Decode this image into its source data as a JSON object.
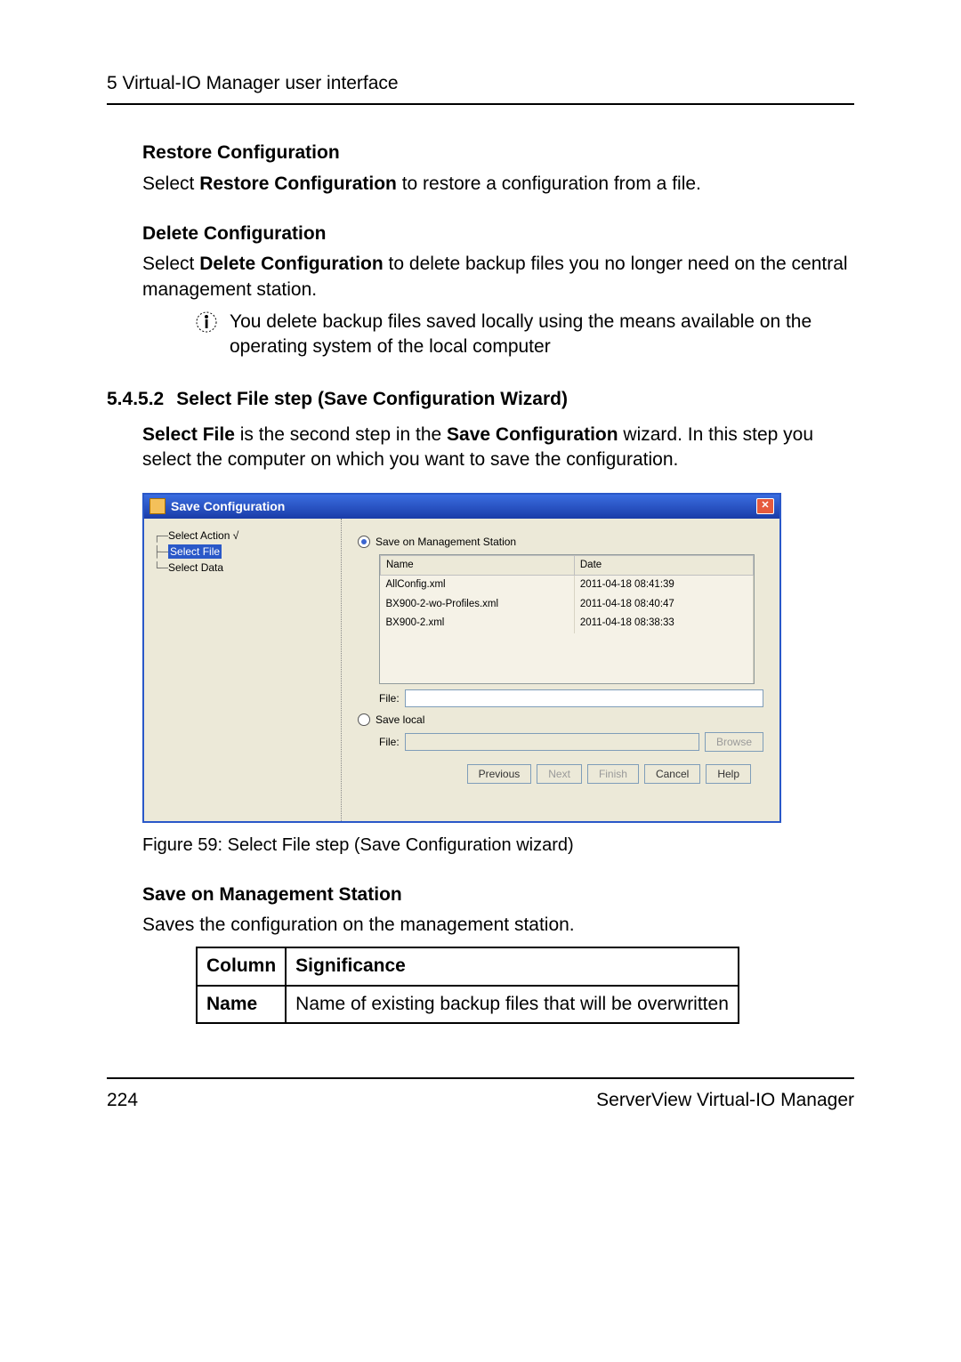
{
  "header": {
    "running": "5 Virtual-IO Manager user interface"
  },
  "restore": {
    "title": "Restore Configuration",
    "text_pre": "Select ",
    "text_bold": "Restore Configuration",
    "text_post": " to restore a configuration from a file."
  },
  "delete": {
    "title": "Delete Configuration",
    "text_pre": "Select ",
    "text_bold": "Delete Configuration",
    "text_post": " to delete backup files you no longer need on the central management station.",
    "note": "You delete backup files saved locally using the means available on the operating system of the local computer"
  },
  "section": {
    "num": "5.4.5.2",
    "title": "Select File step (Save Configuration Wizard)",
    "para_bold1": "Select File",
    "para_mid": " is the second step in the ",
    "para_bold2": "Save Configuration",
    "para_end": " wizard. In this step you select the computer on which you want to save the configuration."
  },
  "wizard": {
    "title": "Save Configuration",
    "tree": {
      "item0": "Select Action √",
      "item1": "Select File",
      "item2": "Select Data"
    },
    "radio_mgmt": "Save on Management Station",
    "radio_local": "Save local",
    "col_name": "Name",
    "col_date": "Date",
    "rows": [
      {
        "name": "AllConfig.xml",
        "date": "2011-04-18 08:41:39"
      },
      {
        "name": "BX900-2-wo-Profiles.xml",
        "date": "2011-04-18 08:40:47"
      },
      {
        "name": "BX900-2.xml",
        "date": "2011-04-18 08:38:33"
      }
    ],
    "file_label": "File:",
    "browse": "Browse",
    "buttons": {
      "prev": "Previous",
      "next": "Next",
      "finish": "Finish",
      "cancel": "Cancel",
      "help": "Help"
    }
  },
  "caption": "Figure 59: Select File step (Save Configuration wizard)",
  "save_mgmt": {
    "title": "Save on Management Station",
    "desc": "Saves the configuration on the management station."
  },
  "sig_table": {
    "h1": "Column",
    "h2": "Significance",
    "r1c1": "Name",
    "r1c2": "Name of existing backup files that will be overwritten"
  },
  "footer": {
    "page": "224",
    "product": "ServerView Virtual-IO Manager"
  }
}
